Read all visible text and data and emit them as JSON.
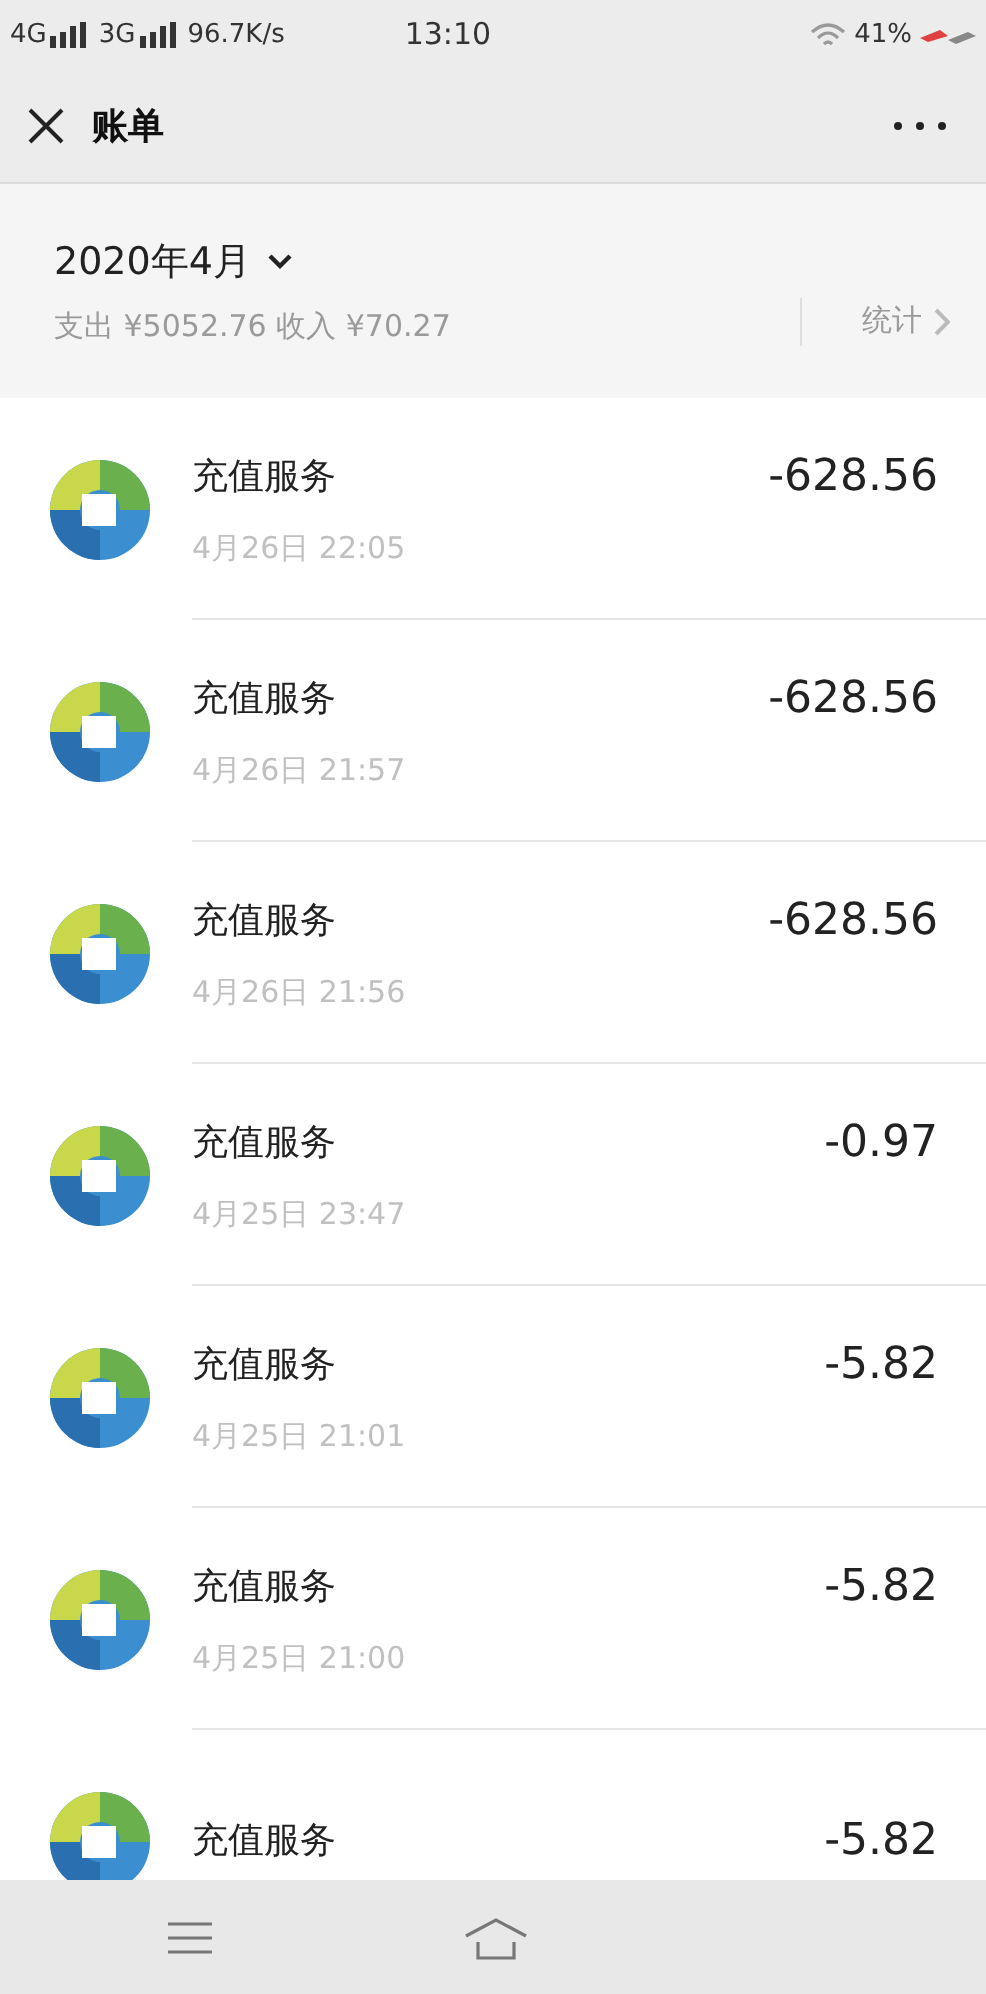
{
  "status_bar": {
    "network_1": "4G",
    "network_2": "3G",
    "speed": "96.7K/s",
    "time": "13:10",
    "battery": "41%"
  },
  "header": {
    "title": "账单"
  },
  "summary": {
    "month": "2020年4月",
    "expense": "支出 ¥5052.76 收入 ¥70.27",
    "stats": "统计"
  },
  "transactions": [
    {
      "name": "充值服务",
      "time": "4月26日 22:05",
      "amount": "-628.56"
    },
    {
      "name": "充值服务",
      "time": "4月26日 21:57",
      "amount": "-628.56"
    },
    {
      "name": "充值服务",
      "time": "4月26日 21:56",
      "amount": "-628.56"
    },
    {
      "name": "充值服务",
      "time": "4月25日 23:47",
      "amount": "-0.97"
    },
    {
      "name": "充值服务",
      "time": "4月25日 21:01",
      "amount": "-5.82"
    },
    {
      "name": "充值服务",
      "time": "4月25日 21:00",
      "amount": "-5.82"
    },
    {
      "name": "充值服务",
      "amount": "-5.82"
    }
  ]
}
